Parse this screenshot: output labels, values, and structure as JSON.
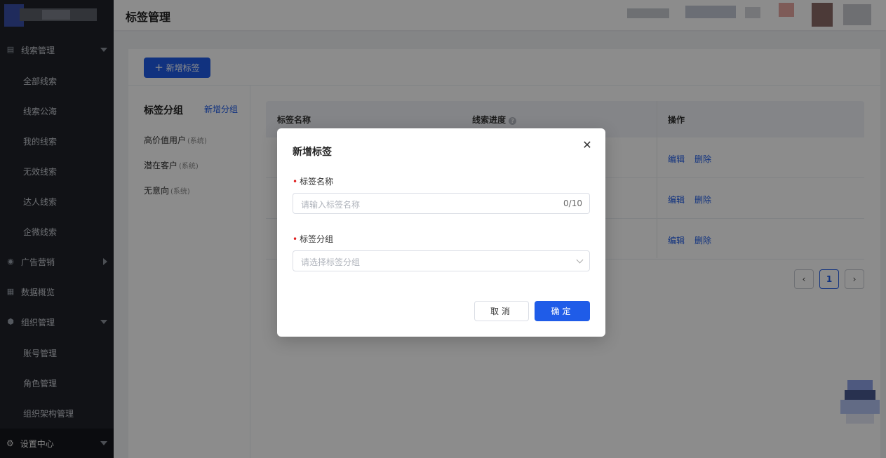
{
  "header": {
    "title": "标签管理"
  },
  "sidebar": {
    "items": [
      {
        "label": "线索管理",
        "icon": "document-icon",
        "expanded": true
      },
      {
        "label": "全部线索"
      },
      {
        "label": "线索公海"
      },
      {
        "label": "我的线索"
      },
      {
        "label": "无效线索"
      },
      {
        "label": "达人线索"
      },
      {
        "label": "企微线索"
      },
      {
        "label": "广告营销",
        "icon": "target-icon",
        "expanded": false
      },
      {
        "label": "数据概览",
        "icon": "chart-icon"
      },
      {
        "label": "组织管理",
        "icon": "shield-icon",
        "expanded": true
      },
      {
        "label": "账号管理"
      },
      {
        "label": "角色管理"
      },
      {
        "label": "组织架构管理"
      },
      {
        "label": "设置中心",
        "icon": "gear-icon",
        "expanded": true
      }
    ]
  },
  "toolbar": {
    "add_tag_label": "新增标签",
    "add_icon": "plus-icon"
  },
  "groups": {
    "title": "标签分组",
    "add_label": "新增分组",
    "items": [
      {
        "name": "高价值用户",
        "suffix": "(系统)"
      },
      {
        "name": "潜在客户",
        "suffix": "(系统)"
      },
      {
        "name": "无意向",
        "suffix": "(系统)"
      }
    ]
  },
  "table": {
    "columns": [
      "标签名称",
      "线索进度",
      "操作"
    ],
    "rows": [
      {
        "edit": "编辑",
        "delete": "删除"
      },
      {
        "edit": "编辑",
        "delete": "删除"
      },
      {
        "edit": "编辑",
        "delete": "删除"
      }
    ]
  },
  "pagination": {
    "current": "1",
    "prev_icon": "chevron-left-icon",
    "next_icon": "chevron-right-icon"
  },
  "modal": {
    "title": "新增标签",
    "close_icon": "close-icon",
    "field_name": {
      "label": "标签名称",
      "placeholder": "请输入标签名称",
      "count": "0/10"
    },
    "field_group": {
      "label": "标签分组",
      "placeholder": "请选择标签分组"
    },
    "cancel_label": "取消",
    "ok_label": "确定"
  },
  "colors": {
    "primary": "#1f5ce8",
    "sidebar_bg": "#1f2229",
    "required": "#e02020"
  }
}
